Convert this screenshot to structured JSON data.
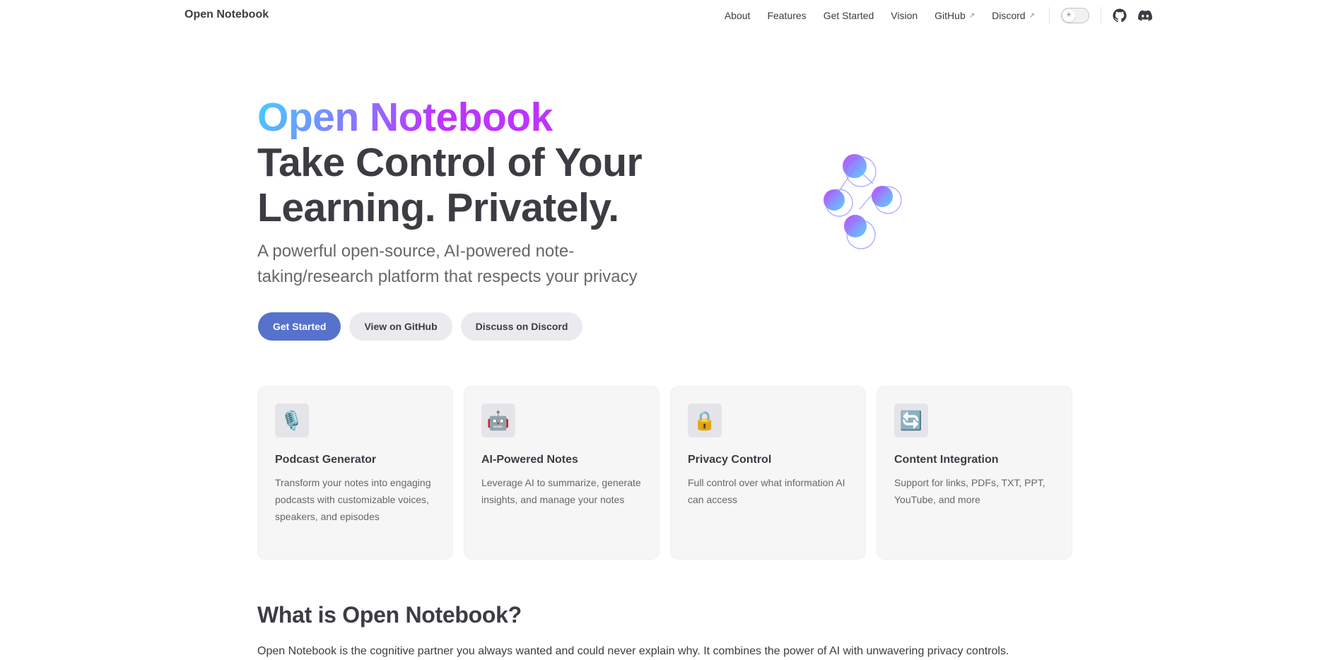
{
  "nav": {
    "brand": "Open Notebook",
    "links": [
      {
        "label": "About"
      },
      {
        "label": "Features"
      },
      {
        "label": "Get Started"
      },
      {
        "label": "Vision"
      },
      {
        "label": "GitHub",
        "external": "↗"
      },
      {
        "label": "Discord",
        "external": "↗"
      }
    ],
    "theme_toggle_icon": "sun-icon",
    "social": [
      "github-icon",
      "discord-icon"
    ]
  },
  "hero": {
    "name": "Open Notebook",
    "text": "Take Control of Your Learning. Privately.",
    "tagline": "A powerful open-source, AI-powered note-taking/research platform that respects your privacy",
    "actions": [
      {
        "label": "Get Started",
        "theme": "brand"
      },
      {
        "label": "View on GitHub",
        "theme": "alt"
      },
      {
        "label": "Discuss on Discord",
        "theme": "alt"
      }
    ],
    "gradient_colors": [
      "#41d1ff",
      "#bd34fe"
    ]
  },
  "features": [
    {
      "icon": "🎙️",
      "icon_name": "microphone-icon",
      "title": "Podcast Generator",
      "details": "Transform your notes into engaging podcasts with customizable voices, speakers, and episodes"
    },
    {
      "icon": "🤖",
      "icon_name": "robot-icon",
      "title": "AI-Powered Notes",
      "details": "Leverage AI to summarize, generate insights, and manage your notes"
    },
    {
      "icon": "🔒",
      "icon_name": "lock-icon",
      "title": "Privacy Control",
      "details": "Full control over what information AI can access"
    },
    {
      "icon": "🔄",
      "icon_name": "refresh-icon",
      "title": "Content Integration",
      "details": "Support for links, PDFs, TXT, PPT, YouTube, and more"
    }
  ],
  "about": {
    "title": "What is Open Notebook?",
    "body": "Open Notebook is the cognitive partner you always wanted and could never explain why. It combines the power of AI with unwavering privacy controls."
  },
  "colors": {
    "brand": "#5672cd",
    "text": "#3c3c43",
    "muted": "#67676c",
    "card_bg": "#f6f6f7"
  }
}
